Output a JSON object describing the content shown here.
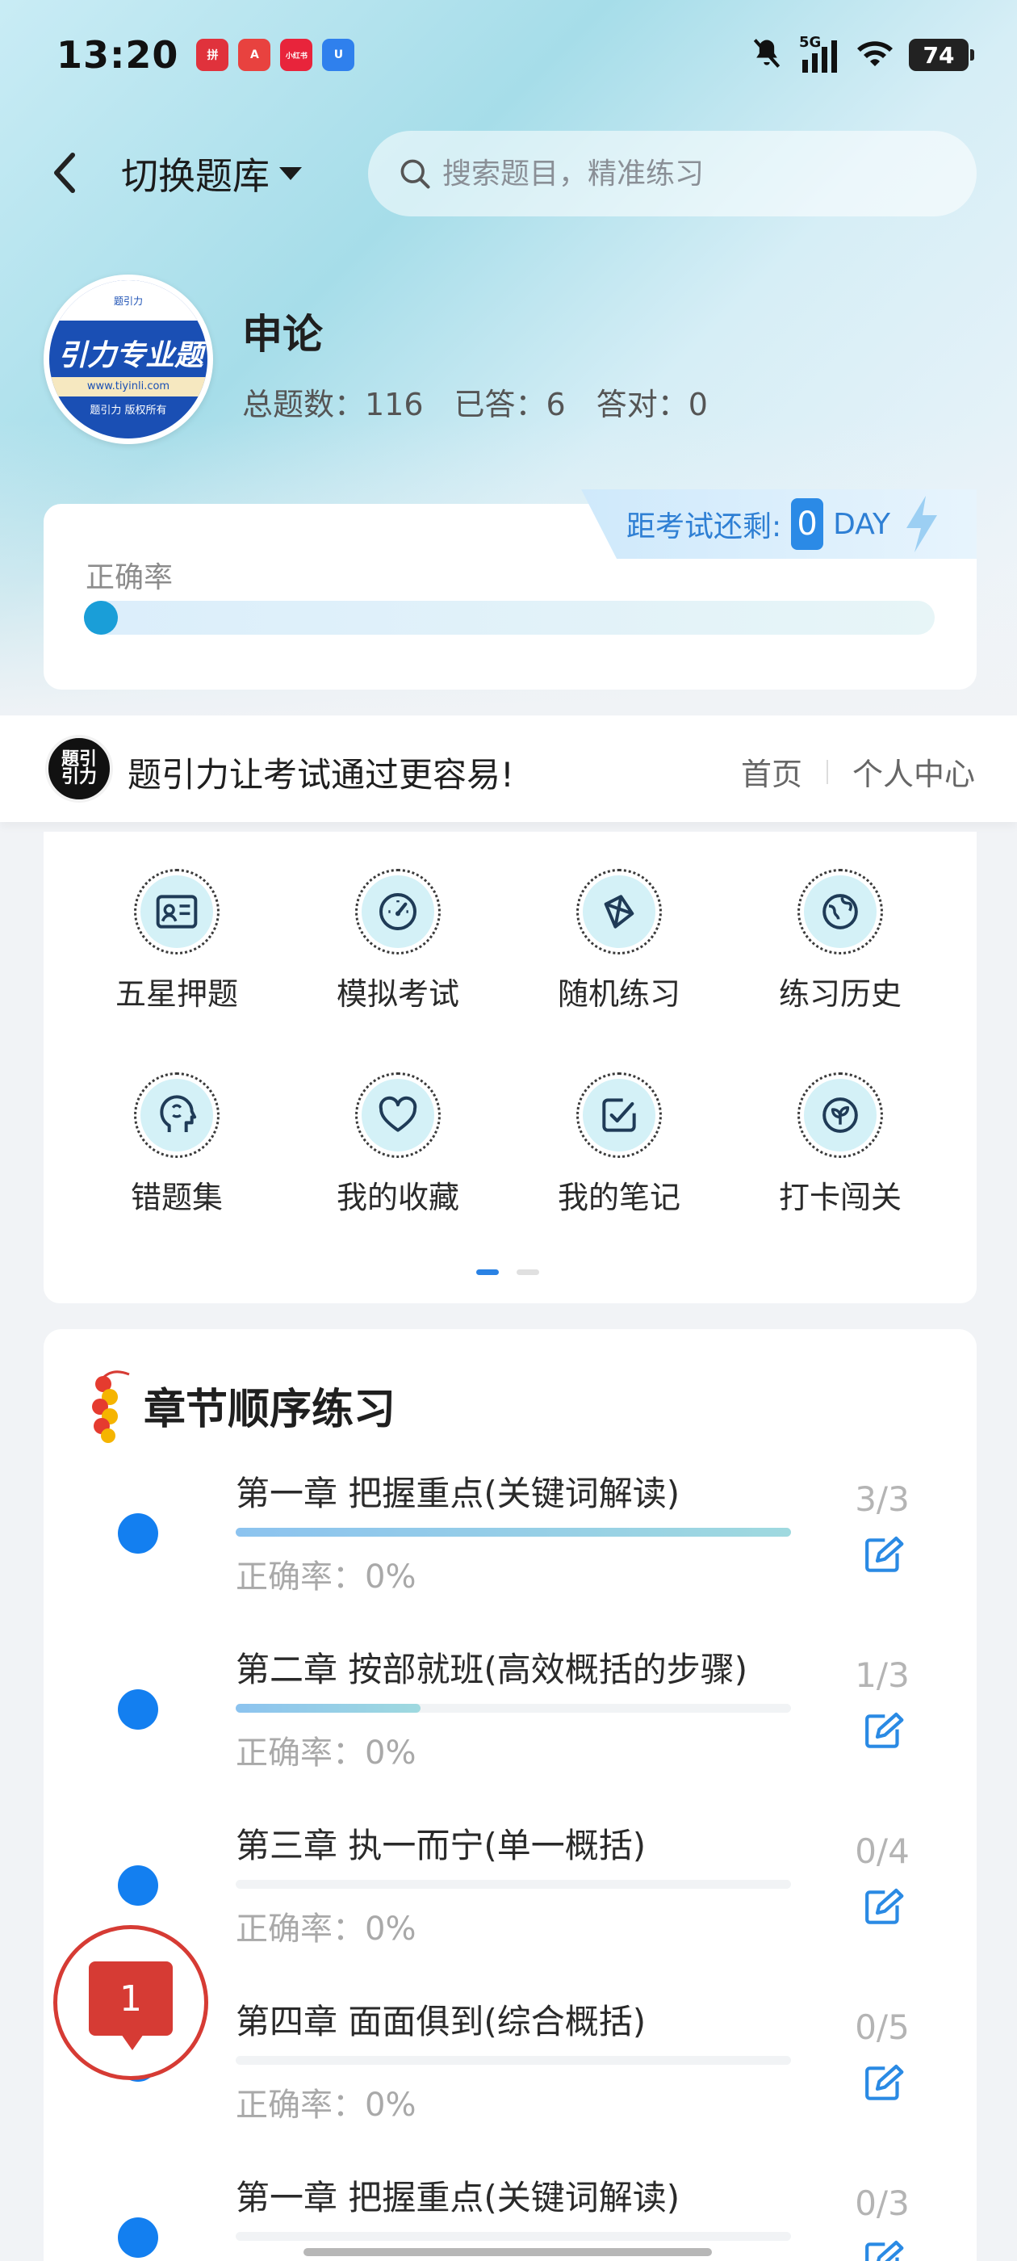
{
  "status_bar": {
    "time": "13:20",
    "battery": "74",
    "network": "5G",
    "app_icons": [
      {
        "name": "pinduoduo-icon",
        "color": "#e0323c",
        "label": "拼"
      },
      {
        "name": "app-a-icon",
        "color": "#e8423f",
        "label": "A"
      },
      {
        "name": "xiaohongshu-icon",
        "color": "#e8243b",
        "label": "小红书"
      },
      {
        "name": "app-u-icon",
        "color": "#2f80ed",
        "label": "U"
      }
    ]
  },
  "header": {
    "switch_label": "切换题库",
    "search_placeholder": "搜索题目，精准练习"
  },
  "subject": {
    "logo_top": "题引力",
    "logo_main": "引力专业题",
    "logo_url": "www.tiyinli.com",
    "logo_copy": "题引力 版权所有",
    "title": "申论",
    "stats": [
      "总题数：116",
      "已答：6",
      "答对：0"
    ]
  },
  "accuracy": {
    "label": "正确率",
    "value": 0,
    "exam_prefix": "距考试还剩:",
    "days": "0",
    "unit": "DAY"
  },
  "slogan": {
    "logo_text_line1": "題引",
    "logo_text_line2": "引力",
    "text": "题引力让考试通过更容易!",
    "links": [
      "首页",
      "个人中心"
    ]
  },
  "functions": [
    {
      "label": "五星押题",
      "icon": "id-card-icon"
    },
    {
      "label": "模拟考试",
      "icon": "speedometer-icon"
    },
    {
      "label": "随机练习",
      "icon": "random-network-icon"
    },
    {
      "label": "练习历史",
      "icon": "globe-history-icon"
    },
    {
      "label": "错题集",
      "icon": "head-brain-icon"
    },
    {
      "label": "我的收藏",
      "icon": "heart-icon"
    },
    {
      "label": "我的笔记",
      "icon": "checked-note-icon"
    },
    {
      "label": "打卡闯关",
      "icon": "leaf-badge-icon"
    }
  ],
  "pager": {
    "pages": 2,
    "active": 0
  },
  "chapters": {
    "title": "章节顺序练习",
    "items": [
      {
        "name": "第一章 把握重点(关键词解读)",
        "accuracy": "正确率：0%",
        "count": "3/3",
        "progress": 1.0
      },
      {
        "name": "第二章 按部就班(高效概括的步骤)",
        "accuracy": "正确率：0%",
        "count": "1/3",
        "progress": 0.333
      },
      {
        "name": "第三章 执一而宁(单一概括)",
        "accuracy": "正确率：0%",
        "count": "0/4",
        "progress": 0
      },
      {
        "name": "第四章 面面俱到(综合概括)",
        "accuracy": "正确率：0%",
        "count": "0/5",
        "progress": 0
      },
      {
        "name": "第一章 把握重点(关键词解读)",
        "accuracy": "",
        "count": "0/3",
        "progress": 0
      }
    ]
  },
  "float_badge": {
    "count": "1"
  },
  "colors": {
    "accent": "#137ff0",
    "float_red": "#d63b34",
    "progress_teal": "#1a9ed8"
  }
}
